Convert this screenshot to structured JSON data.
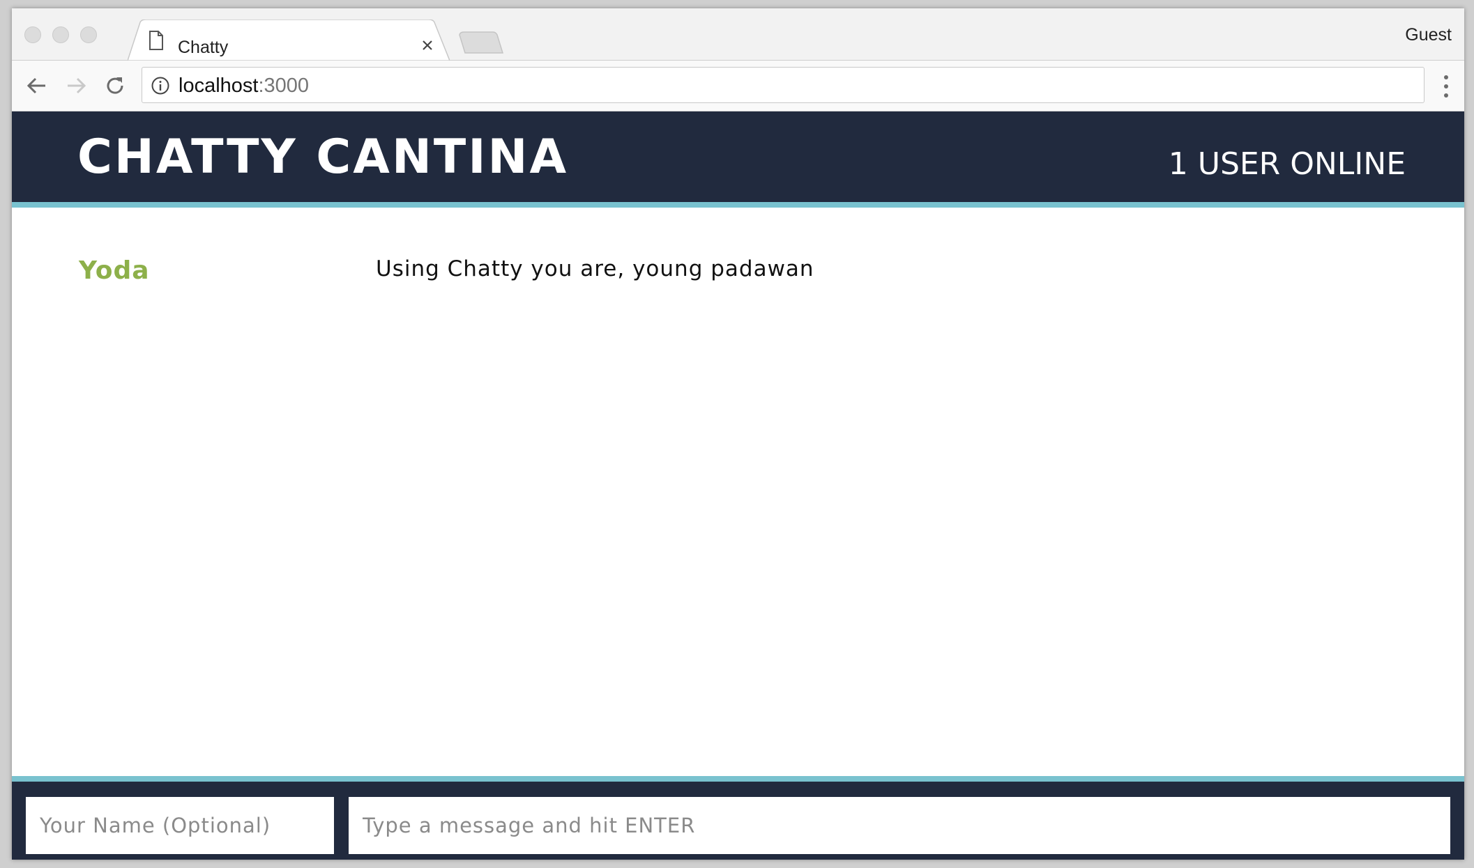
{
  "browser": {
    "tab": {
      "title": "Chatty"
    },
    "profile_label": "Guest",
    "url": {
      "host": "localhost",
      "port": ":3000"
    }
  },
  "app": {
    "brand": "CHATTY CANTINA",
    "user_count": "1 USER ONLINE",
    "brand_color": "#212a3e",
    "accent_color": "#79c2cf",
    "messages": [
      {
        "username": "Yoda",
        "content": "Using Chatty you are, young padawan",
        "username_color": "#8db04a"
      }
    ],
    "chatbar": {
      "name_placeholder": "Your Name (Optional)",
      "message_placeholder": "Type a message and hit ENTER"
    }
  }
}
